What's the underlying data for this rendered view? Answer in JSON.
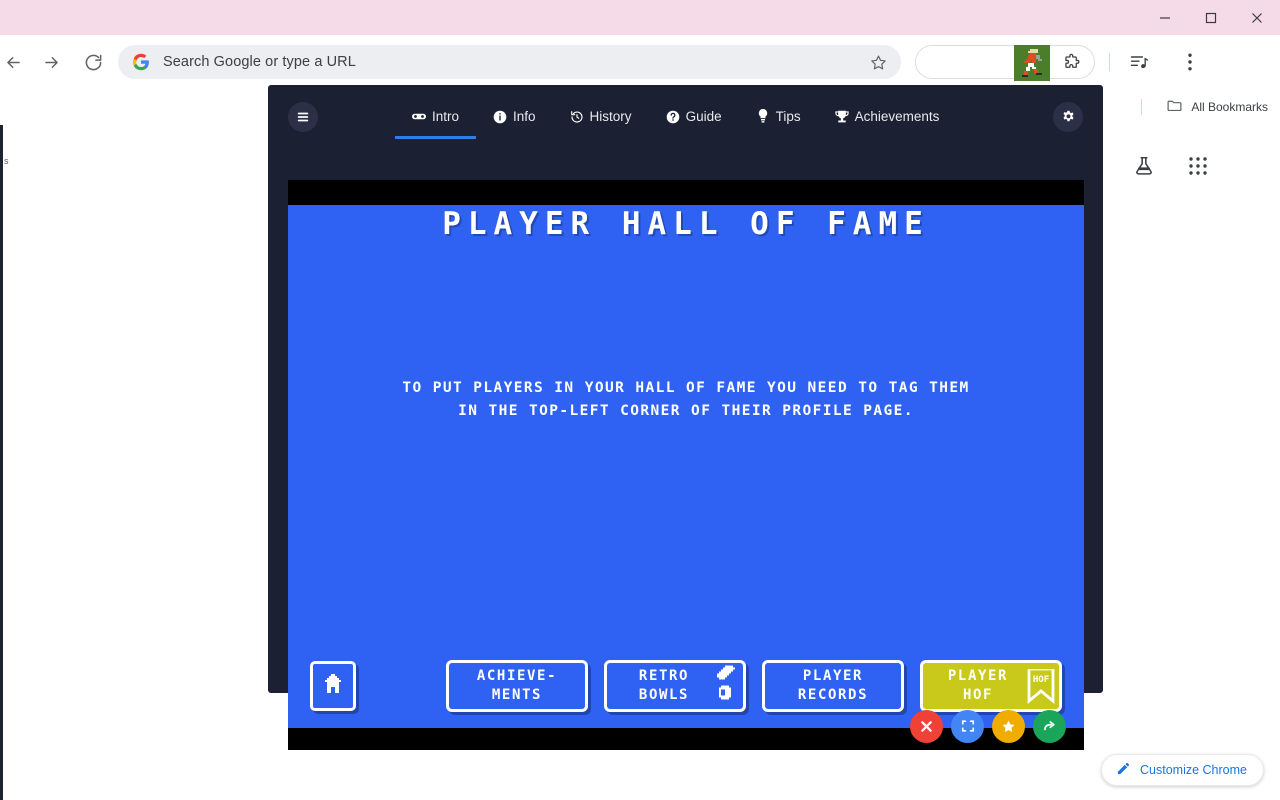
{
  "browser": {
    "window_controls": {
      "minimize": "minimize-icon",
      "maximize": "maximize-icon",
      "close": "close-icon"
    },
    "titlebar_color": "#f5dbe8",
    "nav": {
      "back": "back-arrow-icon",
      "forward": "forward-arrow-icon",
      "reload": "reload-icon"
    },
    "omnibox": {
      "placeholder": "Search Google or type a URL",
      "value": "",
      "leading_icon": "google-g-icon",
      "bookmark_icon": "star-icon"
    },
    "extension_favicon": "retro-bowl-player-icon",
    "extensions_icon": "puzzle-piece-icon",
    "media_icon": "media-playlist-icon",
    "menu_icon": "three-dot-menu-icon",
    "bookmarks": {
      "all_bookmarks_label": "All Bookmarks",
      "folder_icon": "folder-icon"
    },
    "ntp": {
      "labs_icon": "lab-flask-icon",
      "apps_icon": "google-apps-grid-icon",
      "customize_label": "Customize Chrome",
      "customize_icon": "pencil-icon",
      "customize_color": "#1a73e8"
    }
  },
  "game": {
    "menu_button_icon": "hamburger-menu-icon",
    "settings_icon": "gear-icon",
    "nav_tabs": [
      {
        "label": "Intro",
        "icon": "gamepad-icon",
        "active": true
      },
      {
        "label": "Info",
        "icon": "info-circle-icon",
        "active": false
      },
      {
        "label": "History",
        "icon": "history-icon",
        "active": false
      },
      {
        "label": "Guide",
        "icon": "question-circle-icon",
        "active": false
      },
      {
        "label": "Tips",
        "icon": "lightbulb-icon",
        "active": false
      },
      {
        "label": "Achievements",
        "icon": "trophy-icon",
        "active": false
      }
    ],
    "active_tab_color": "#2f7ee8",
    "screen": {
      "background_color": "#2f62f2",
      "title": "PLAYER HALL OF FAME",
      "body_line_1": "TO PUT PLAYERS IN YOUR HALL OF FAME YOU NEED TO TAG THEM",
      "body_line_2": "IN THE TOP-LEFT CORNER OF THEIR PROFILE PAGE."
    },
    "home_button": {
      "icon": "home-icon"
    },
    "menu_buttons": [
      {
        "label": "ACHIEVE-\nMENTS",
        "line1": "ACHIEVE-",
        "line2": "MENTS",
        "active": false,
        "icon": ""
      },
      {
        "label": "RETRO BOWLS",
        "line1": "RETRO",
        "line2": "BOWLS",
        "active": false,
        "icon": "trophy-pixel-icon"
      },
      {
        "label": "PLAYER RECORDS",
        "line1": "PLAYER",
        "line2": "RECORDS",
        "active": false,
        "icon": ""
      },
      {
        "label": "PLAYER HOF",
        "line1": "PLAYER",
        "line2": "HOF",
        "active": true,
        "icon": "hof-banner-icon",
        "icon_text": "HOF",
        "color": "#c9c91b"
      }
    ],
    "action_buttons": [
      {
        "name": "close",
        "icon": "x-icon",
        "color": "#ef4136"
      },
      {
        "name": "fullscreen",
        "icon": "fullscreen-icon",
        "color": "#4285f4"
      },
      {
        "name": "favorite",
        "icon": "star-filled-icon",
        "color": "#f0ad00"
      },
      {
        "name": "share",
        "icon": "share-arrow-icon",
        "color": "#1aa55b"
      }
    ]
  }
}
